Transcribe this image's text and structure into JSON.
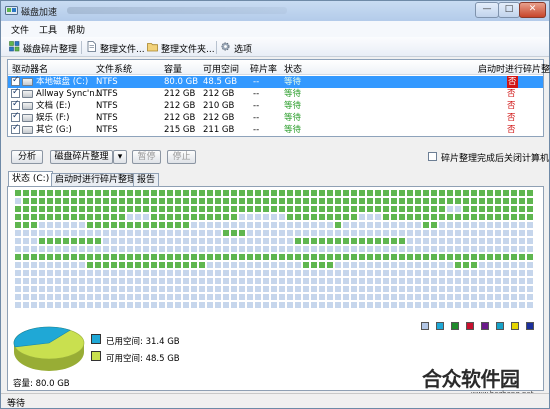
{
  "window": {
    "title": "磁盘加速",
    "controls": {
      "minimize": "—",
      "maximize": "□",
      "close": "✕"
    }
  },
  "menu": [
    "文件",
    "工具",
    "帮助"
  ],
  "toolbar": [
    {
      "label": "磁盘碎片整理",
      "icon": "defrag-icon"
    },
    {
      "label": "整理文件...",
      "icon": "document-icon"
    },
    {
      "label": "整理文件夹...",
      "icon": "folder-icon"
    },
    {
      "label": "选项",
      "icon": "gear-icon"
    }
  ],
  "drives": {
    "columns": [
      "驱动器名",
      "文件系统",
      "容量",
      "可用空间",
      "碎片率",
      "状态",
      "启动时进行碎片整理"
    ],
    "rows": [
      {
        "name": "本地磁盘 (C:)",
        "fs": "NTFS",
        "capacity": "80.0 GB",
        "free": "48.5 GB",
        "frag": "--",
        "status": "等待",
        "boot": "否",
        "checked": true,
        "selected": true
      },
      {
        "name": "Allway Sync'n...",
        "fs": "NTFS",
        "capacity": "212 GB",
        "free": "212 GB",
        "frag": "--",
        "status": "等待",
        "boot": "否",
        "checked": true,
        "selected": false
      },
      {
        "name": "文档 (E:)",
        "fs": "NTFS",
        "capacity": "212 GB",
        "free": "210 GB",
        "frag": "--",
        "status": "等待",
        "boot": "否",
        "checked": true,
        "selected": false
      },
      {
        "name": "娱乐 (F:)",
        "fs": "NTFS",
        "capacity": "212 GB",
        "free": "212 GB",
        "frag": "--",
        "status": "等待",
        "boot": "否",
        "checked": true,
        "selected": false
      },
      {
        "name": "其它 (G:)",
        "fs": "NTFS",
        "capacity": "215 GB",
        "free": "211 GB",
        "frag": "--",
        "status": "等待",
        "boot": "否",
        "checked": true,
        "selected": false
      }
    ]
  },
  "actions": {
    "analyze": "分析",
    "defrag": "磁盘碎片整理",
    "dropdown": "▾",
    "pause": "暂停",
    "stop": "停止",
    "shutdown_label": "碎片整理完成后关闭计算机"
  },
  "tabs": [
    "状态 (C:)",
    "启动时进行碎片整理",
    "报告"
  ],
  "legend_colors": [
    "#b3c7e6",
    "#1fa8d6",
    "#1f8a2b",
    "#c8102e",
    "#6a1b8a",
    "#17a2c8",
    "#e6d600",
    "#1b2f9c"
  ],
  "usage": {
    "used_label": "已用空间: 31.4 GB",
    "free_label": "可用空间: 48.5 GB",
    "used_color": "#1fa8d6",
    "free_color": "#c9e04f",
    "used_fraction": 0.3925,
    "capacity_label": "容量: 80.0 GB"
  },
  "cluster_colors": {
    "used": "#5fb64f",
    "free": "#c6d6ec"
  },
  "status_bar": "等待",
  "watermark": {
    "text": "合众软件园",
    "url": "www.hezhong.net"
  }
}
